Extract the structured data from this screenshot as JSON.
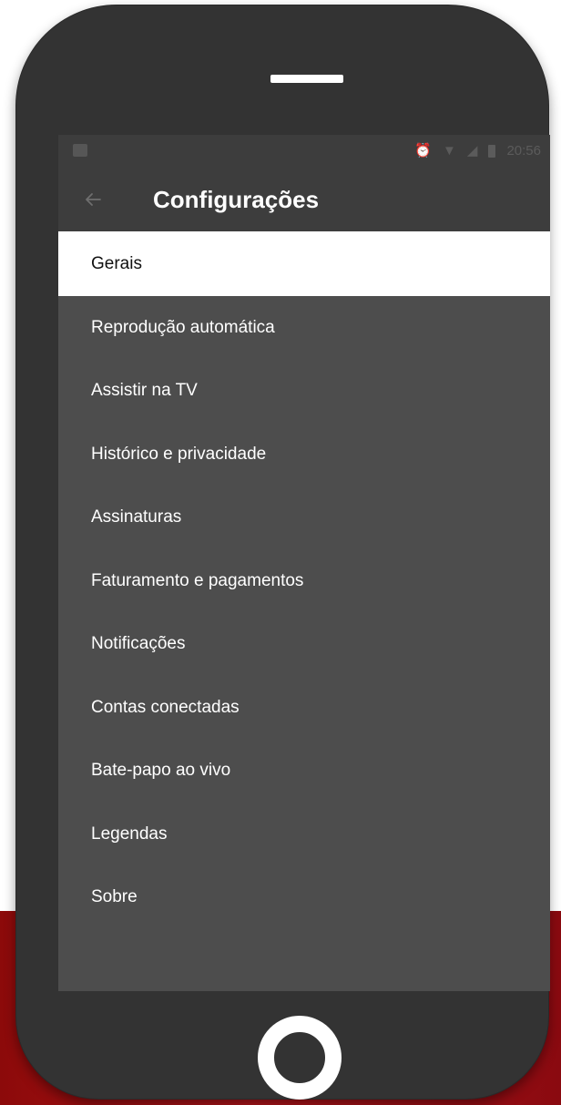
{
  "status_bar": {
    "time": "20:56",
    "icons": [
      "image-icon",
      "alarm-icon",
      "wifi-icon",
      "signal-icon",
      "battery-icon"
    ]
  },
  "app_bar": {
    "back_icon": "arrow-left-icon",
    "title": "Configurações"
  },
  "menu": {
    "items": [
      {
        "label": "Gerais",
        "selected": true
      },
      {
        "label": "Reprodução automática",
        "selected": false
      },
      {
        "label": "Assistir na TV",
        "selected": false
      },
      {
        "label": "Histórico e privacidade",
        "selected": false
      },
      {
        "label": "Assinaturas",
        "selected": false
      },
      {
        "label": "Faturamento e pagamentos",
        "selected": false
      },
      {
        "label": "Notificações",
        "selected": false
      },
      {
        "label": "Contas conectadas",
        "selected": false
      },
      {
        "label": "Bate-papo ao vivo",
        "selected": false
      },
      {
        "label": "Legendas",
        "selected": false
      },
      {
        "label": "Sobre",
        "selected": false
      }
    ]
  },
  "colors": {
    "screen_bg": "#4d4d4d",
    "app_bar_bg": "#3d3d3d",
    "selected_bg": "#ffffff",
    "phone_body": "#333333",
    "background_accent": "#b4151b"
  }
}
